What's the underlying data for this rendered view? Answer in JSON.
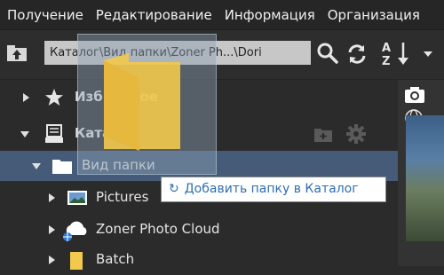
{
  "menu": [
    "Получение",
    "Редактирование",
    "Информация",
    "Организация"
  ],
  "toolbar": {
    "path": "Каталог\\Вид папки\\Zoner Ph...\\Dori",
    "sort_icon_text": "A Z"
  },
  "tree": {
    "favorites": "Избранное",
    "catalog": "Каталог",
    "folder_view": "Вид папки",
    "pictures": "Pictures",
    "zoner_cloud": "Zoner Photo Cloud",
    "batch": "Batch"
  },
  "tooltip": {
    "icon": "↻",
    "text": "Добавить папку в Каталог"
  },
  "colors": {
    "selected_row": "#465b78",
    "tooltip_text": "#2f6db5",
    "folder_yellow": "#f2c94c"
  }
}
